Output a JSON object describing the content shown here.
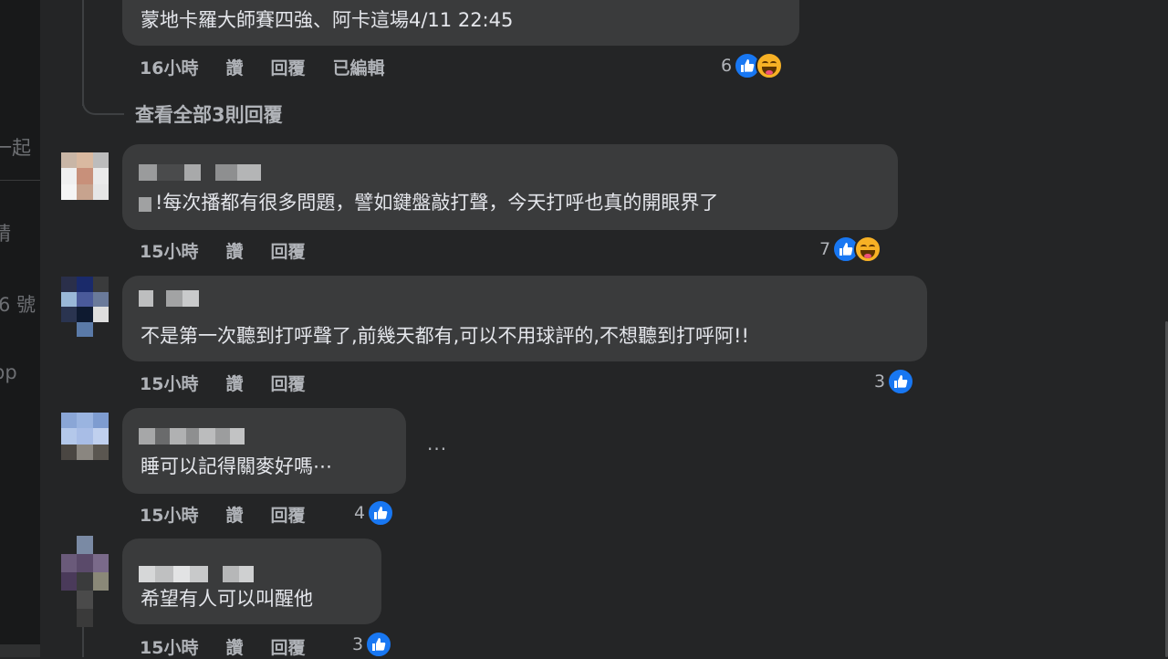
{
  "left_panel": {
    "cut_text_1": "一起",
    "cut_text_2": "精",
    "cut_text_3": "6 號",
    "cut_text_4": "pp"
  },
  "top_comment": {
    "text": "蒙地卡羅大師賽四強、阿卡這場4/11 22:45",
    "time": "16小時",
    "like_label": "讚",
    "reply_label": "回覆",
    "edited_label": "已編輯",
    "reaction_count": "6",
    "reaction_icons": [
      "like-icon",
      "haha-icon"
    ]
  },
  "view_replies": {
    "label": "查看全部3則回覆"
  },
  "comments": [
    {
      "text": "!每次播都有很多問題，譬如鍵盤敲打聲，今天打呼也真的開眼界了",
      "time": "15小時",
      "like_label": "讚",
      "reply_label": "回覆",
      "reaction_count": "7",
      "reaction_icons": [
        "like-icon",
        "haha-icon"
      ]
    },
    {
      "text": "不是第一次聽到打呼聲了,前幾天都有,可以不用球評的,不想聽到打呼阿!!",
      "time": "15小時",
      "like_label": "讚",
      "reply_label": "回覆",
      "reaction_count": "3",
      "reaction_icons": [
        "like-icon"
      ]
    },
    {
      "text": "睡可以記得關麥好嗎⋯",
      "time": "15小時",
      "like_label": "讚",
      "reply_label": "回覆",
      "reaction_count": "4",
      "reaction_icons": [
        "like-icon"
      ],
      "more_label": "···"
    },
    {
      "text": "希望有人可以叫醒他",
      "time": "15小時",
      "like_label": "讚",
      "reply_label": "回覆",
      "reaction_count": "3",
      "reaction_icons": [
        "like-icon"
      ]
    }
  ],
  "colors": {
    "background": "#242526",
    "bubble": "#3a3b3c",
    "text": "#e4e6eb",
    "secondary_text": "#b0b3b8",
    "like_blue": "#1877f2",
    "haha_yellow": "#f7b125"
  }
}
